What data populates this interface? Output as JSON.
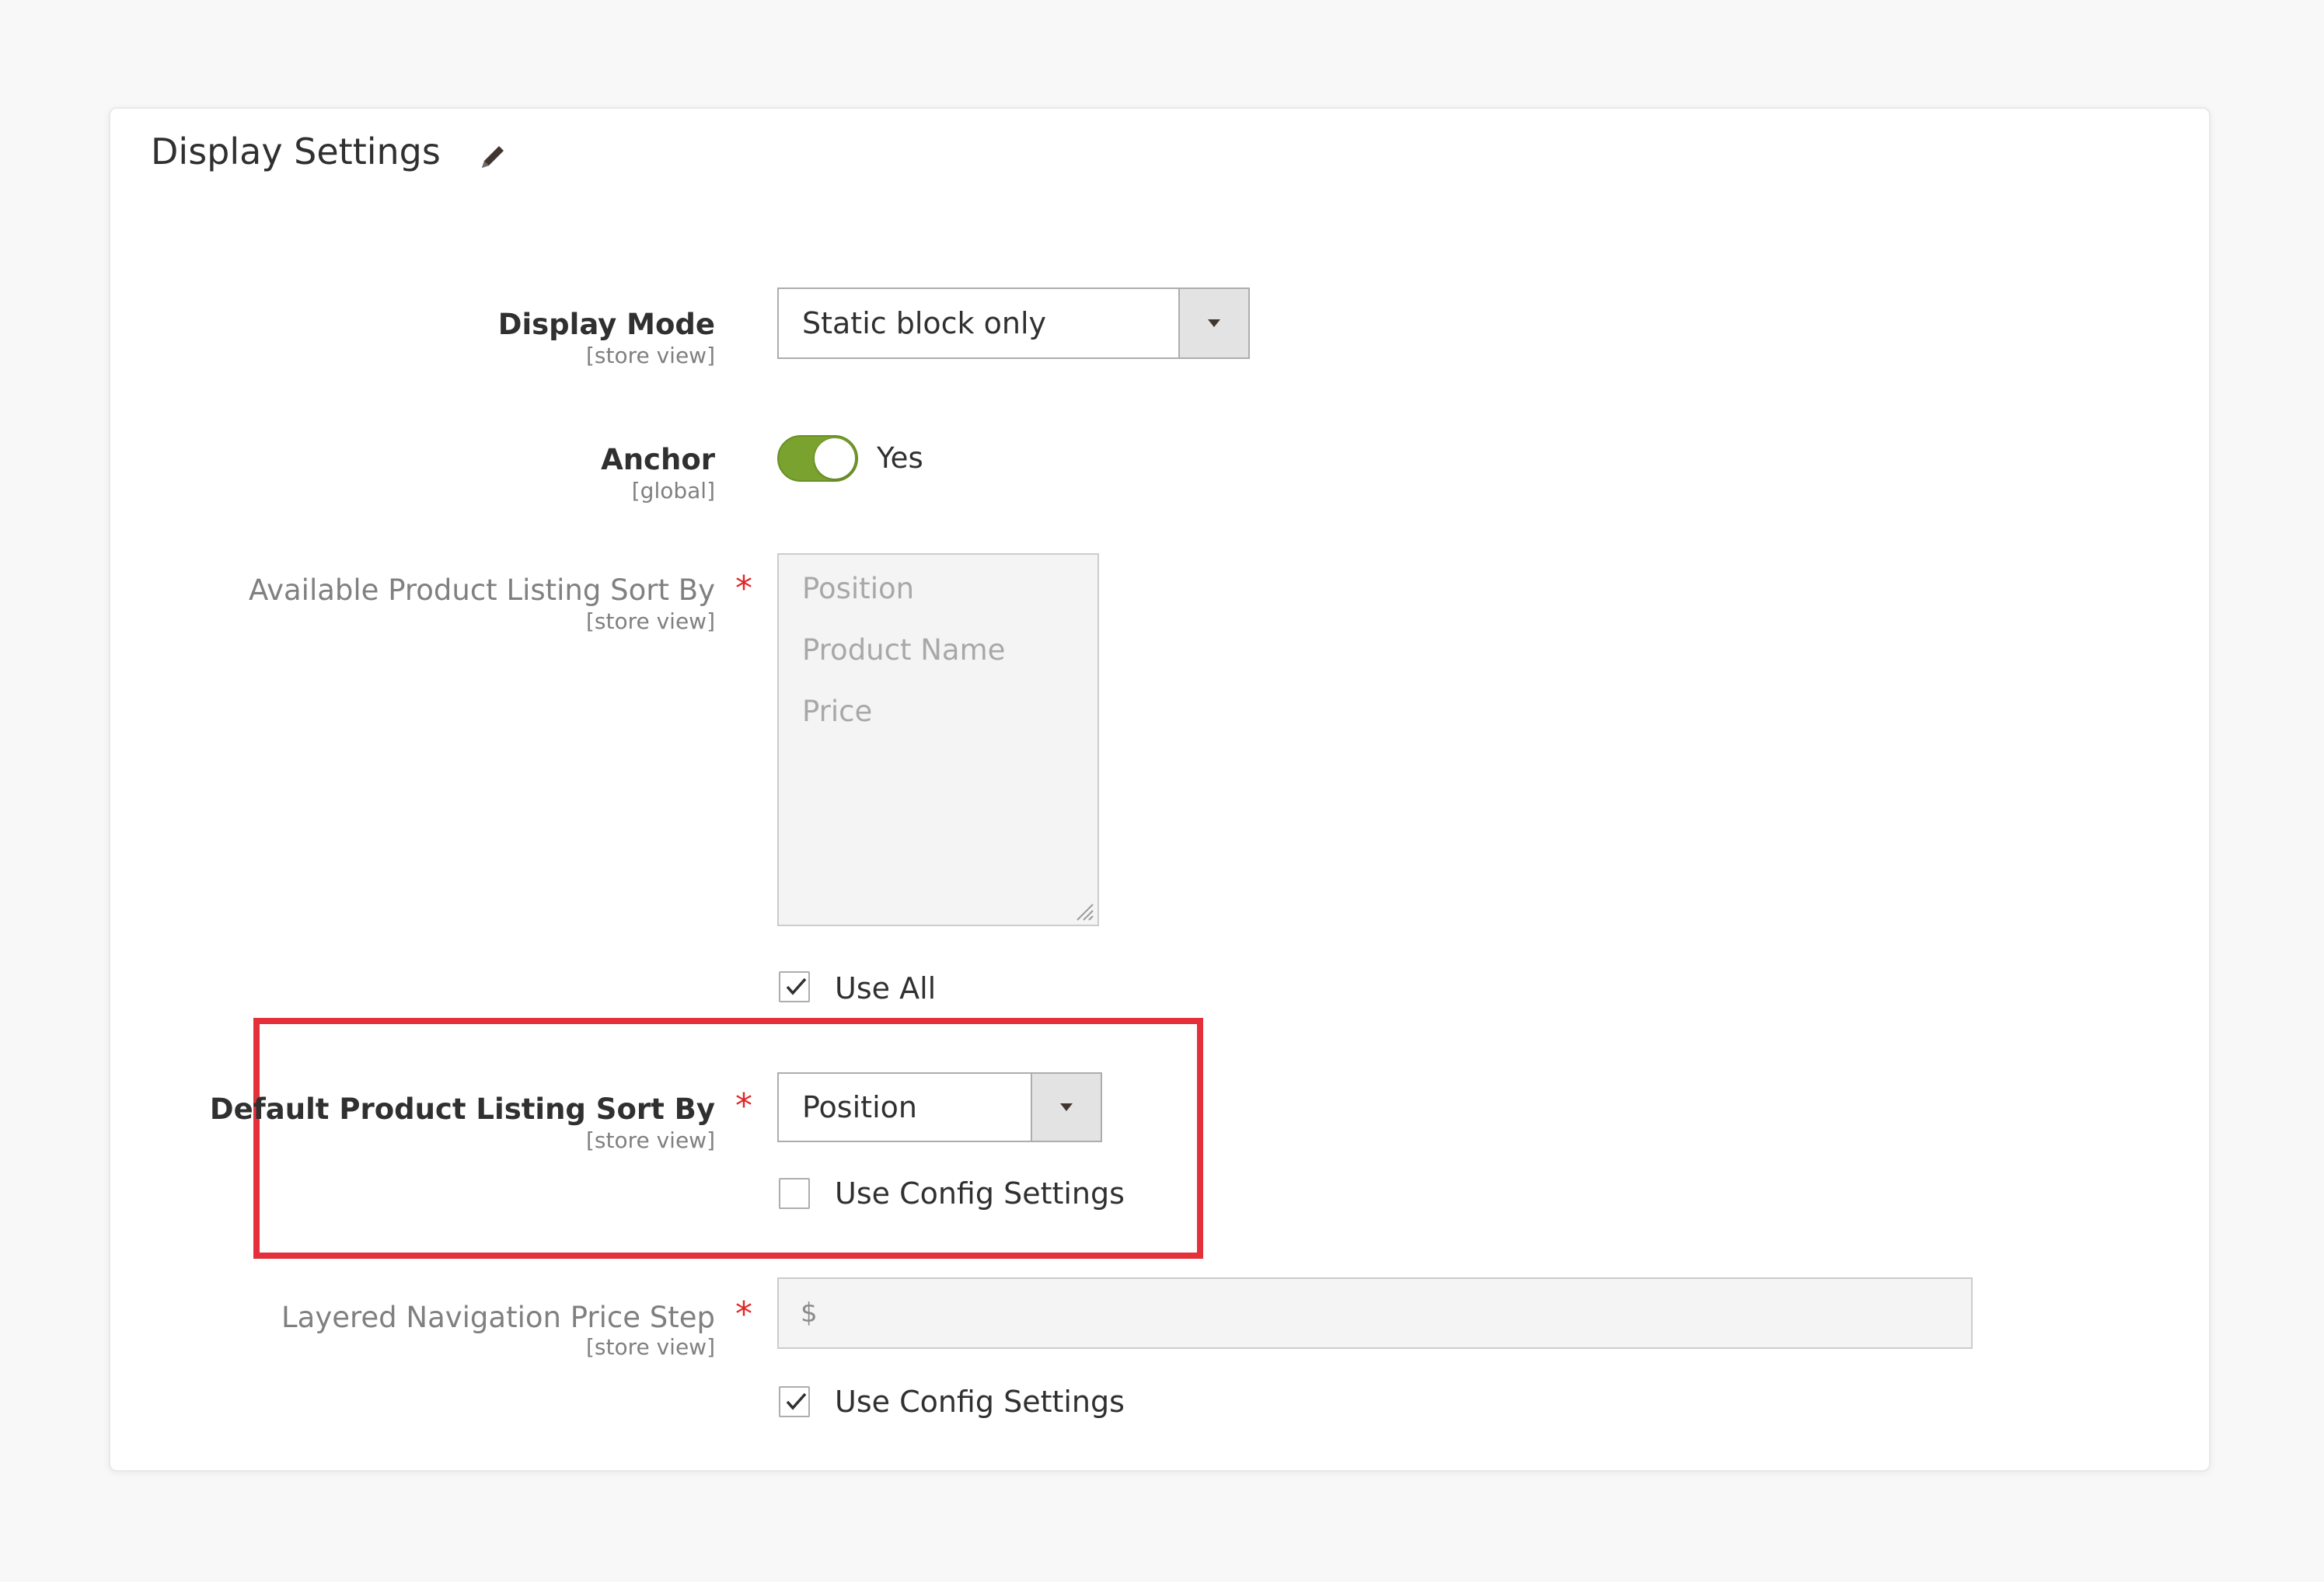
{
  "section": {
    "title": "Display Settings"
  },
  "display_mode": {
    "label": "Display Mode",
    "scope": "[store view]",
    "value": "Static block only"
  },
  "anchor": {
    "label": "Anchor",
    "scope": "[global]",
    "value_text": "Yes",
    "enabled": true
  },
  "available_sort_by": {
    "label": "Available Product Listing Sort By",
    "required_mark": "*",
    "scope": "[store view]",
    "options": [
      "Position",
      "Product Name",
      "Price"
    ],
    "use_all_label": "Use All",
    "use_all_checked": true
  },
  "default_sort_by": {
    "label": "Default Product Listing Sort By",
    "required_mark": "*",
    "scope": "[store view]",
    "value": "Position",
    "use_config_label": "Use Config Settings",
    "use_config_checked": false
  },
  "price_step": {
    "label": "Layered Navigation Price Step",
    "required_mark": "*",
    "scope": "[store view]",
    "currency_prefix": "$",
    "value": "",
    "use_config_label": "Use Config Settings",
    "use_config_checked": true
  },
  "colors": {
    "toggle_on": "#79a22e",
    "required": "#e22626",
    "highlight": "#e3303b"
  }
}
